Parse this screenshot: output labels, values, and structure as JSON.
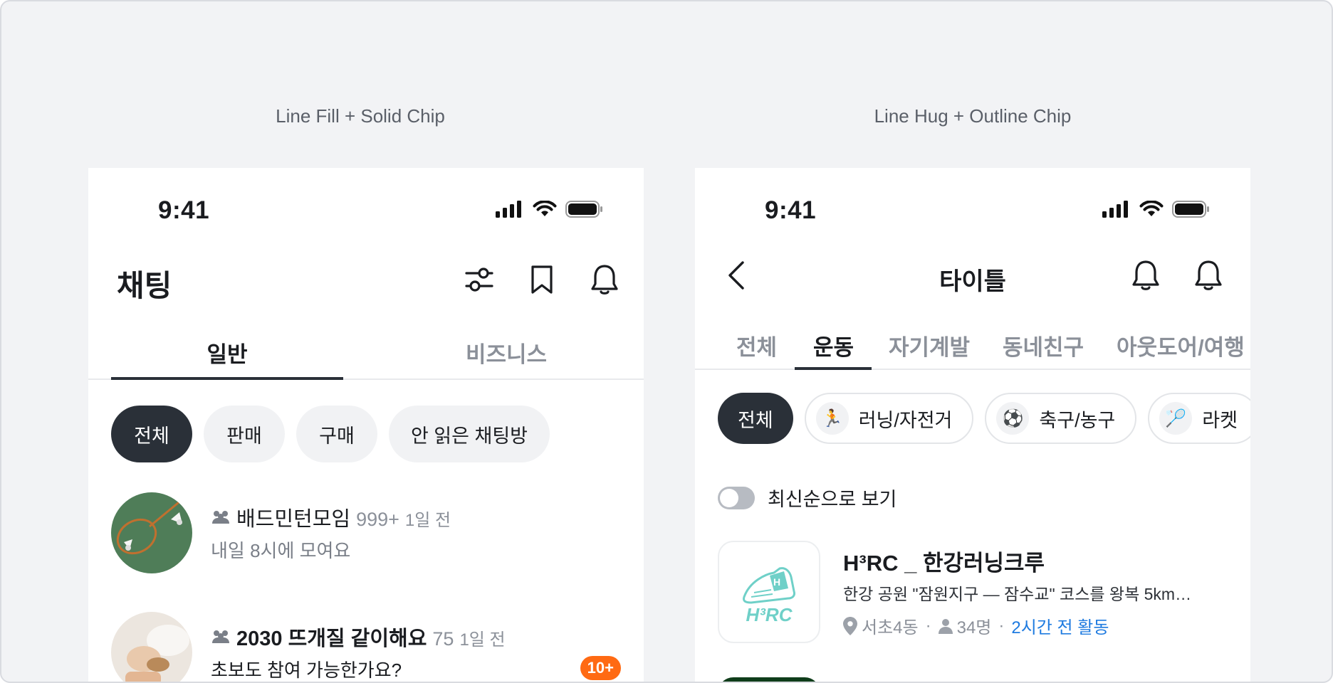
{
  "captions": {
    "left": "Line Fill + Solid Chip",
    "right": "Line Hug + Outline Chip"
  },
  "status_bar": {
    "time": "9:41"
  },
  "left_phone": {
    "title": "채팅",
    "header_icons": [
      "sliders-icon",
      "bookmark-icon",
      "bell-icon"
    ],
    "tabs": [
      {
        "label": "일반",
        "active": true
      },
      {
        "label": "비즈니스",
        "active": false
      }
    ],
    "chips": [
      {
        "label": "전체",
        "selected": true
      },
      {
        "label": "판매",
        "selected": false
      },
      {
        "label": "구매",
        "selected": false
      },
      {
        "label": "안 읽은 채팅방",
        "selected": false
      }
    ],
    "rooms": [
      {
        "name": "배드민턴모임",
        "count": "999+",
        "time": "1일 전",
        "message": "내일 8시에 모여요",
        "unread": ""
      },
      {
        "name": "2030 뜨개질 같이해요",
        "count": "75",
        "time": "1일 전",
        "message": "초보도 참여 가능한가요?",
        "unread": "10+"
      }
    ]
  },
  "right_phone": {
    "title": "타이틀",
    "tabs": [
      {
        "label": "전체",
        "active": false
      },
      {
        "label": "운동",
        "active": true
      },
      {
        "label": "자기계발",
        "active": false
      },
      {
        "label": "동네친구",
        "active": false
      },
      {
        "label": "아웃도어/여행",
        "active": false
      }
    ],
    "chips": [
      {
        "label": "전체",
        "selected": true,
        "emoji": ""
      },
      {
        "label": "러닝/자전거",
        "selected": false,
        "emoji": "🏃"
      },
      {
        "label": "축구/농구",
        "selected": false,
        "emoji": "⚽"
      },
      {
        "label": "라켓",
        "selected": false,
        "emoji": "🏸"
      }
    ],
    "toggle": {
      "label": "최신순으로 보기",
      "on": false
    },
    "club": {
      "title": "H³RC _ 한강러닝크루",
      "description": "한강 공원 \"잠원지구 — 잠수교\" 코스를 왕복 5km…",
      "location": "서초4동",
      "members": "34명",
      "activity": "2시간 전 활동",
      "logo_text": "H³RC"
    }
  },
  "colors": {
    "chip_selected": "#2a3038",
    "unread_badge": "#ff6a13",
    "activity_link": "#1f7be0",
    "logo_teal": "#6fd0c8"
  }
}
